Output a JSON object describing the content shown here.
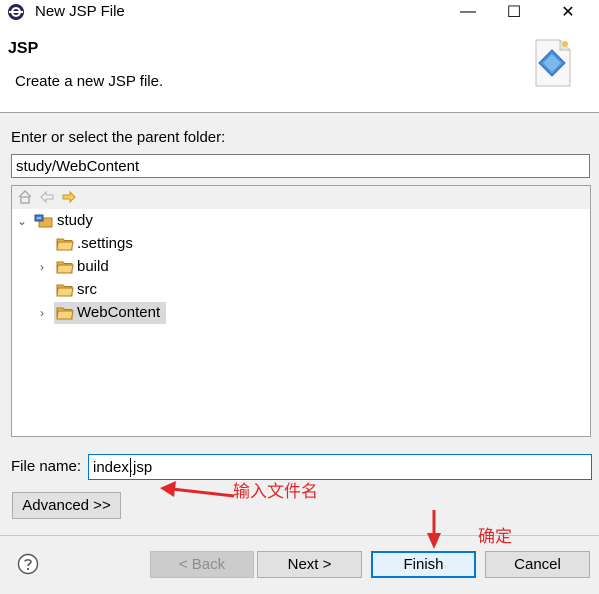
{
  "window": {
    "title": "New JSP File",
    "minimize_glyph": "—",
    "maximize_glyph": "☐",
    "close_glyph": "✕"
  },
  "banner": {
    "title": "JSP",
    "description": "Create a new JSP file."
  },
  "parent_folder": {
    "label": "Enter or select the parent folder:",
    "value": "study/WebContent"
  },
  "tree": {
    "toolbar_icons": [
      "home-icon",
      "back-arrow-icon",
      "forward-arrow-icon"
    ],
    "items": [
      {
        "label": "study",
        "level": 0,
        "expanded": true,
        "icon": "project-icon"
      },
      {
        "label": ".settings",
        "level": 1,
        "expandable": false,
        "icon": "folder-icon"
      },
      {
        "label": "build",
        "level": 1,
        "expandable": true,
        "icon": "folder-icon"
      },
      {
        "label": "src",
        "level": 1,
        "expandable": false,
        "icon": "folder-icon"
      },
      {
        "label": "WebContent",
        "level": 1,
        "expandable": true,
        "selected": true,
        "icon": "folder-icon"
      }
    ]
  },
  "file_name": {
    "label": "File name:",
    "value": "index.jsp"
  },
  "buttons": {
    "advanced": "Advanced >>",
    "back": "< Back",
    "next": "Next >",
    "finish": "Finish",
    "cancel": "Cancel"
  },
  "annotations": {
    "filename_hint": "输入文件名",
    "confirm_hint": "确定",
    "color": "#e0282a"
  },
  "colors": {
    "accent": "#0078d7",
    "folder": "#e8b24a"
  }
}
